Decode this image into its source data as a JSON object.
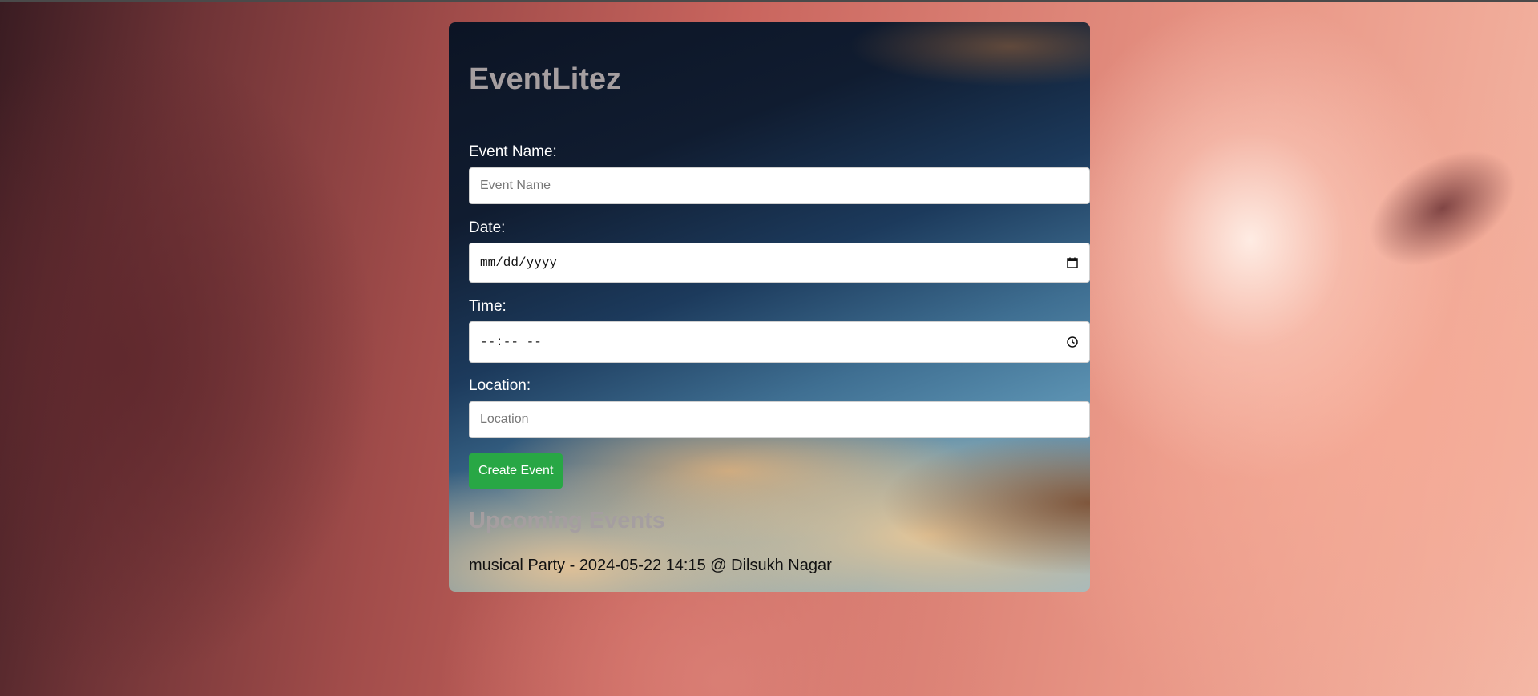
{
  "app": {
    "title": "EventLitez"
  },
  "form": {
    "event_name": {
      "label": "Event Name:",
      "placeholder": "Event Name",
      "value": ""
    },
    "date": {
      "label": "Date:",
      "display": "mm/dd/yyyy",
      "icon": "calendar-icon"
    },
    "time": {
      "label": "Time:",
      "display": "--:-- --",
      "icon": "clock-icon"
    },
    "location": {
      "label": "Location:",
      "placeholder": "Location",
      "value": ""
    },
    "submit_label": "Create Event"
  },
  "upcoming": {
    "title": "Upcoming Events",
    "events": [
      {
        "text": "musical Party - 2024-05-22 14:15 @ Dilsukh Nagar"
      }
    ]
  },
  "colors": {
    "accent_button": "#28a745",
    "title_text": "#a59ea0",
    "label_text": "#ffffff"
  }
}
